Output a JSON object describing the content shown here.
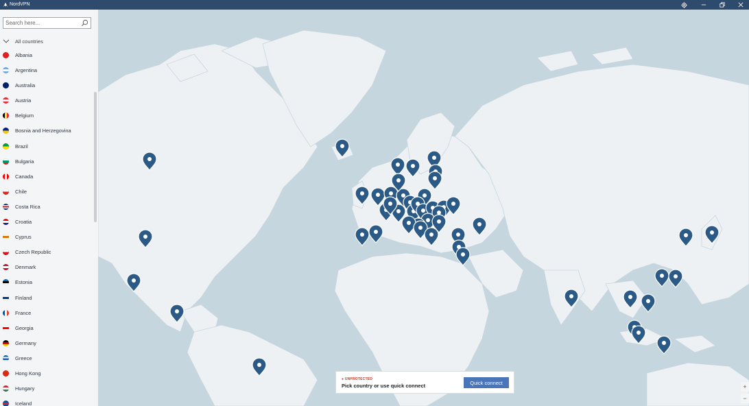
{
  "window": {
    "title": "NordVPN",
    "controls": [
      "settings-icon",
      "minimize-icon",
      "restore-icon",
      "close-icon"
    ]
  },
  "sidebar": {
    "search_placeholder": "Search here...",
    "all_countries_label": "All countries",
    "countries": [
      {
        "name": "Albania",
        "flag": [
          "#e41e20"
        ]
      },
      {
        "name": "Argentina",
        "flag": [
          "#74acdf",
          "#ffffff",
          "#74acdf"
        ]
      },
      {
        "name": "Australia",
        "flag": [
          "#012169"
        ]
      },
      {
        "name": "Austria",
        "flag": [
          "#ed2939",
          "#ffffff",
          "#ed2939"
        ]
      },
      {
        "name": "Belgium",
        "flag": [
          "#000000",
          "#fae042",
          "#ed2939"
        ],
        "vertical": true
      },
      {
        "name": "Bosnia and Herzegovina",
        "flag": [
          "#002395",
          "#fecb00"
        ]
      },
      {
        "name": "Brazil",
        "flag": [
          "#009b3a",
          "#fedf00"
        ]
      },
      {
        "name": "Bulgaria",
        "flag": [
          "#ffffff",
          "#00966e",
          "#d62612"
        ]
      },
      {
        "name": "Canada",
        "flag": [
          "#ff0000",
          "#ffffff",
          "#ff0000"
        ],
        "vertical": true
      },
      {
        "name": "Chile",
        "flag": [
          "#ffffff",
          "#d52b1e"
        ]
      },
      {
        "name": "Costa Rica",
        "flag": [
          "#002b7f",
          "#ffffff",
          "#ce1126",
          "#ffffff",
          "#002b7f"
        ]
      },
      {
        "name": "Croatia",
        "flag": [
          "#ff0000",
          "#ffffff",
          "#171796"
        ]
      },
      {
        "name": "Cyprus",
        "flag": [
          "#ffffff",
          "#d57800",
          "#ffffff"
        ]
      },
      {
        "name": "Czech Republic",
        "flag": [
          "#ffffff",
          "#d7141a"
        ]
      },
      {
        "name": "Denmark",
        "flag": [
          "#c8102e",
          "#ffffff",
          "#c8102e"
        ]
      },
      {
        "name": "Estonia",
        "flag": [
          "#0072ce",
          "#000000",
          "#ffffff"
        ]
      },
      {
        "name": "Finland",
        "flag": [
          "#ffffff",
          "#003580",
          "#ffffff"
        ]
      },
      {
        "name": "France",
        "flag": [
          "#0055a4",
          "#ffffff",
          "#ef4135"
        ],
        "vertical": true
      },
      {
        "name": "Georgia",
        "flag": [
          "#ffffff",
          "#ff0000",
          "#ffffff"
        ]
      },
      {
        "name": "Germany",
        "flag": [
          "#000000",
          "#dd0000",
          "#ffce00"
        ]
      },
      {
        "name": "Greece",
        "flag": [
          "#0d5eaf",
          "#ffffff",
          "#0d5eaf",
          "#ffffff"
        ]
      },
      {
        "name": "Hong Kong",
        "flag": [
          "#de2910"
        ]
      },
      {
        "name": "Hungary",
        "flag": [
          "#ce2939",
          "#ffffff",
          "#477050"
        ]
      },
      {
        "name": "Iceland",
        "flag": [
          "#02529c",
          "#dc1e35",
          "#02529c"
        ]
      }
    ]
  },
  "status": {
    "state_label": "UNPROTECTED",
    "message": "Pick country or use quick connect",
    "quick_connect_label": "Quick connect"
  },
  "map": {
    "zoom_in_label": "+",
    "zoom_out_label": "−"
  },
  "colors": {
    "titlebar": "#2e4a6c",
    "ocean": "#c5d6df",
    "land": "#eef1f3",
    "pin": "#2b5a86",
    "accent": "#4a75b8",
    "unprotected": "#c0392b"
  }
}
